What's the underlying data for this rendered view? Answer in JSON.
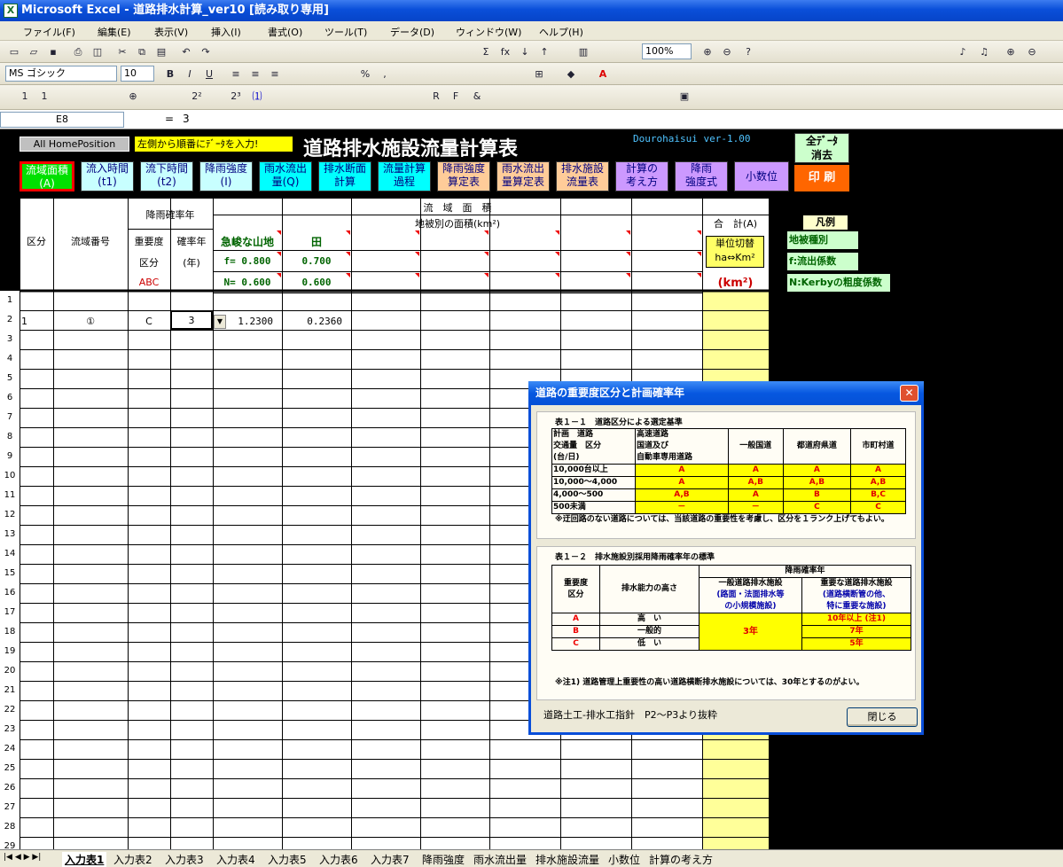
{
  "window": {
    "title": "Microsoft Excel - 道路排水計算_ver10 [読み取り専用]"
  },
  "menu": [
    "ファイル(F)",
    "編集(E)",
    "表示(V)",
    "挿入(I)",
    "書式(O)",
    "ツール(T)",
    "データ(D)",
    "ウィンドウ(W)",
    "ヘルプ(H)"
  ],
  "toolbar": {
    "zoom": "100%",
    "font": "MS ゴシック",
    "font_size": "10",
    "bold": "B",
    "italic": "I",
    "underline": "U",
    "percent": "%",
    "comma": ",",
    "formula_eq": "="
  },
  "formula_bar": {
    "cell": "E8",
    "value": "3"
  },
  "sheet": {
    "home_button": "All HomePosition",
    "hint": "左側から順番にﾃﾞｰﾀを入力!",
    "title": "道路排水施設流量計算表",
    "version": "Dourohaisui ver-1.00",
    "clear_all": [
      "全ﾃﾞｰﾀ",
      "消去"
    ],
    "print": "印 刷",
    "nav_buttons": [
      {
        "l1": "流域面積",
        "l2": "(A)",
        "bg": "#00e000"
      },
      {
        "l1": "流入時間",
        "l2": "(t1)",
        "bg": "#c8ffff"
      },
      {
        "l1": "流下時間",
        "l2": "(t2)",
        "bg": "#c8ffff"
      },
      {
        "l1": "降雨強度",
        "l2": "(I)",
        "bg": "#c8ffff"
      },
      {
        "l1": "雨水流出",
        "l2": "量(Q)",
        "bg": "#00ffff"
      },
      {
        "l1": "排水断面",
        "l2": "計算",
        "bg": "#00ffff"
      },
      {
        "l1": "流量計算",
        "l2": "過程",
        "bg": "#00ffff"
      },
      {
        "l1": "降雨強度",
        "l2": "算定表",
        "bg": "#ffcc99"
      },
      {
        "l1": "雨水流出",
        "l2": "量算定表",
        "bg": "#ffcc99"
      },
      {
        "l1": "排水施設",
        "l2": "流量表",
        "bg": "#ffcc99"
      },
      {
        "l1": "計算の",
        "l2": "考え方",
        "bg": "#cc99ff"
      },
      {
        "l1": "降雨",
        "l2": "強度式",
        "bg": "#cc99ff"
      },
      {
        "l1": "小数位",
        "l2": "",
        "bg": "#cc99ff"
      }
    ],
    "headers": {
      "kubun": "区分",
      "ryuiki_no": "流域番号",
      "rain_prob": "降雨確率年",
      "importance": "重要度",
      "importance2": "区分",
      "importance3": "ABC",
      "prob": "確率年",
      "prob2": "(年)",
      "area": "流　域　面　積",
      "area_by_cover": "地被別の面積(km²)",
      "total": "合　計(A)",
      "unit_switch": [
        "単位切替",
        "ha⇔Km²"
      ],
      "unit": "(km²)",
      "cover1": "急峻な山地",
      "cover2": "田",
      "f_label": "f= 0.800",
      "f2": "0.700",
      "n_label": "N= 0.600",
      "n2": "0.600"
    },
    "legend": {
      "title": "凡例",
      "items": [
        "地被種別",
        "f:流出係数",
        "N:Kerbyの粗度係数"
      ]
    },
    "rows": [
      "1",
      "2",
      "3",
      "4",
      "5",
      "6",
      "7",
      "8",
      "9",
      "10",
      "11",
      "12",
      "13",
      "14",
      "15",
      "16",
      "17",
      "18",
      "19",
      "20",
      "21",
      "22",
      "23",
      "24",
      "25",
      "26",
      "27",
      "28",
      "29"
    ],
    "data_row": {
      "kubun": "1",
      "no": "①",
      "importance": "C",
      "prob": "3",
      "v1": "1.2300",
      "v2": "0.2360"
    }
  },
  "sheet_tabs": [
    "入力表1",
    "入力表2",
    "入力表3",
    "入力表4",
    "入力表5",
    "入力表6",
    "入力表7",
    "降雨強度",
    "雨水流出量",
    "排水施設流量",
    "小数位",
    "計算の考え方"
  ],
  "dialog": {
    "title": "道路の重要度区分と計画確率年",
    "t1_title": "表１－１　道路区分による選定基準",
    "t1_head": [
      "計画　道路",
      "交通量　区分",
      "(台/日)",
      "高速道路",
      "国道及び",
      "自動車専用道路",
      "一般国道",
      "都道府県道",
      "市町村道"
    ],
    "t1_rows": [
      [
        "10,000台以上",
        "A",
        "A",
        "A",
        "A"
      ],
      [
        "10,000～4,000",
        "A",
        "A,B",
        "A,B",
        "A,B"
      ],
      [
        "4,000～500",
        "A,B",
        "A",
        "B",
        "B,C"
      ],
      [
        "500未満",
        "－",
        "－",
        "C",
        "C"
      ]
    ],
    "t1_note": "※迂回路のない道路については、当該道路の重要性を考慮し、区分を１ランク上げてもよい。",
    "t2_title": "表１－２　排水施設別採用降雨確率年の標準",
    "t2_head": [
      "重要度",
      "区分",
      "排水能力の高さ",
      "降雨確率年",
      "一般道路排水施設",
      "(路面・法面排水等",
      "の小規模施設)",
      "重要な道路排水施設",
      "(道路横断管の他、",
      "特に重要な施設)"
    ],
    "t2_rows": [
      [
        "A",
        "高　い",
        "10年以上 (注1)"
      ],
      [
        "B",
        "一般的",
        "7年"
      ],
      [
        "C",
        "低　い",
        "5年"
      ]
    ],
    "t2_general": "3年",
    "t2_note": "※注1) 道路管理上重要性の高い道路横断排水施設については、30年とするのがよい。",
    "source": "道路土工-排水工指針　P2～P3より抜粋",
    "close": "閉じる"
  }
}
